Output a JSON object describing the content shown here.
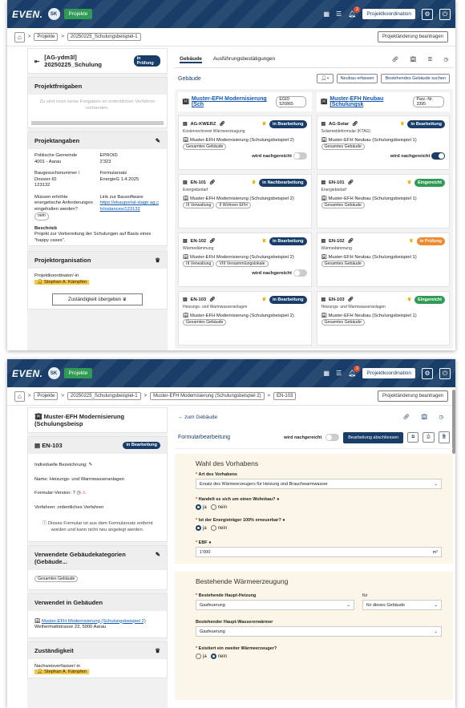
{
  "common": {
    "logo": "EVEN.",
    "avatar": "SK",
    "env": "Projekte",
    "role": "Projektkoordination",
    "project_change": "Projektänderung beantragen",
    "home": "⌂",
    "sep": ">"
  },
  "s1": {
    "crumbs": [
      "Projekte",
      "20250225_Schulungsbeispiel-1"
    ],
    "title": "[AG-ydm3l] 20250225_Schulung",
    "title_status": "in Prüfung",
    "freigaben_head": "Projektfreigaben",
    "freigaben_text": "Zu sind noch keine Freigaben im ordentlichen Verfahren vorhanden.",
    "angaben_head": "Projektangaben",
    "fields": [
      {
        "k": "Politische Gemeinde",
        "v": "4001 - Aarau",
        "k2": "EPROID",
        "v2": "2'323"
      },
      {
        "k": "Baugesuchsnummer / Dossier-ID",
        "v": "123132",
        "k2": "Formularsatz",
        "v2": "EnergieG 1.4.2025"
      },
      {
        "k": "Müssen erhöhte energetische Anforderungen eingehalten werden?",
        "v": "nein",
        "k2": "Link zur Bausoftware",
        "v2": "https://ebauportal-stage.ag.ch/instances/123132"
      }
    ],
    "beschrieb_k": "Beschrieb",
    "beschrieb_v": "Projekt zur Vorbereitung der Schulungen auf Basis eines \"happy cases\".",
    "org_head": "Projektorganisation",
    "org_role": "Projektkoordinator/-in",
    "org_person": "Stephan A. Kämpfen",
    "org_btn": "Zuständigkeit übergeben",
    "tabs": [
      "Gebäude",
      "Ausführungsbestätigungen"
    ],
    "gebaeude_head": "Gebäude",
    "btn_new": "Neubau erfassen",
    "btn_search": "Bestehendes Gebäude suchen",
    "col1": {
      "title": "Muster-EFH Modernisierung (Sch",
      "egid": "EGID 520865",
      "items": [
        {
          "code": "AG-KWERZ",
          "sub": "Kostenrechnerei Wärmeerzeugung",
          "status": "in Bearbeitung",
          "sc": "bb",
          "line": "Muster-EFH Modernisierung (Schulungsbeispiel 2)",
          "tags": [
            "Gesamtes Gebäude"
          ],
          "foot": "wird nachgereicht"
        },
        {
          "code": "EN-101",
          "sub": "Energiebedarf",
          "status": "in Nachbearbeitung",
          "sc": "bb",
          "line": "Muster-EFH Modernisierung (Schulungsbeispiel 2)",
          "tags": [
            "III Verwaltung",
            "II Wohnen EFH"
          ],
          "foot": ""
        },
        {
          "code": "EN-102",
          "sub": "Wärmedämmung",
          "status": "in Bearbeitung",
          "sc": "bb",
          "line": "Muster-EFH Modernisierung (Schulungsbeispiel 2)",
          "tags": [
            "III Verwaltung",
            "VIII Versammlungslokale"
          ],
          "foot": "wird nachgereicht"
        },
        {
          "code": "EN-103",
          "sub": "Heizungs- und Warmwasseranlagen",
          "status": "in Bearbeitung",
          "sc": "bb",
          "line": "Muster-EFH Modernisierung (Schulungsbeispiel 2)",
          "tags": [
            "Gesamtes Gebäude"
          ],
          "foot": ""
        }
      ]
    },
    "col2": {
      "title": "Muster-EFH Neubau (Schulungsk",
      "egid": "Parz.-Nr. 3395",
      "items": [
        {
          "code": "AG-Solar",
          "sub": "Solarmeldeformular (KTAG)",
          "status": "in Bearbeitung",
          "sc": "bb",
          "line": "Muster-EFH Neubau (Schulungsbeispiel 1)",
          "tags": [
            "Gesamtes Gebäude"
          ],
          "foot": "wird nachgereicht"
        },
        {
          "code": "EN-101",
          "sub": "Energiebedarf",
          "status": "Eingereicht",
          "sc": "bg",
          "line": "Muster-EFH Neubau (Schulungsbeispiel 1)",
          "tags": [
            "Gesamtes Gebäude"
          ],
          "foot": ""
        },
        {
          "code": "EN-102",
          "sub": "Wärmedämmung",
          "status": "in Prüfung",
          "sc": "bo",
          "line": "Muster-EFH Neubau (Schulungsbeispiel 1)",
          "tags": [
            "Gesamtes Gebäude"
          ],
          "foot": ""
        },
        {
          "code": "EN-103",
          "sub": "Heizungs- und Warmwasseranlagen",
          "status": "Eingereicht",
          "sc": "bg",
          "line": "Muster-EFH Neubau (Schulungsbeispiel 1)",
          "tags": [
            "Gesamtes Gebäude"
          ],
          "foot": ""
        }
      ]
    }
  },
  "s2": {
    "crumbs": [
      "Projekte",
      "20250225_Schulungsbeispiel-1",
      "Muster-EFH Modernisierung (Schulungsbeispiel 2)",
      "EN-103"
    ],
    "bldg": "Muster-EFH Modernisierung (Schulungsbeisp",
    "form_code": "EN-103",
    "form_status": "in Bearbeitung",
    "rows": [
      {
        "k": "Individuelle Bezeichnung:",
        "v": ""
      },
      {
        "k": "Name:",
        "v": "Heizungs- und Warmwasseranlagen"
      },
      {
        "k": "Formular-Version:",
        "v": "7"
      },
      {
        "k": "Verfahren:",
        "v": "ordentliches Verfahren"
      }
    ],
    "warn": "Dieses Formular ist aus dem Formularsatz entfernt worden und kann nicht neu angelegt werden.",
    "cat_head": "Verwendete Gebäudekategorien (Gebäude...",
    "cat_tag": "Gesamtes Gebäude",
    "used_head": "Verwendet in Gebäuden",
    "used_line": "Muster-EFH Modernisierung (Schulungsbeispiel 2)",
    "used_addr": "Weihermattstrasse 23, 5000 Aarau",
    "zust_head": "Zuständigkeit",
    "zust_role": "Nachweisverfasser/-in",
    "zust_person": "Stephan A. Kämpfen",
    "back": "← zum Gebäude",
    "fb_head": "Formularbearbeitung",
    "fb_toggle": "wird nachgereicht",
    "fb_btn": "Bearbeitung abschliessen",
    "sec1_title": "Wahl des Vorhabens",
    "q1": "Art des Vorhabens",
    "a1": "Ersatz des Wärmeerzeugers für Heizung und Brauchwarmwasser",
    "q2": "Handelt es sich um einen Wohnbau?",
    "q3": "Ist der Energieträger 100% erneuerbar?",
    "yes": "ja",
    "no": "nein",
    "q4": "EBF",
    "a4": "1'000",
    "unit": "m²",
    "sec2_title": "Bestehende Wärmeerzeugung",
    "q5": "Bestehende Haupt-Heizung",
    "a5": "Gasfeuerung",
    "q5b": "für",
    "a5b": "für dieses Gebäude",
    "q6": "Bestehender Haupt-Wassererwärmer",
    "a6": "Gasfeuerung",
    "q7": "Existiert ein zweiter Wärmeerzeuger?"
  }
}
